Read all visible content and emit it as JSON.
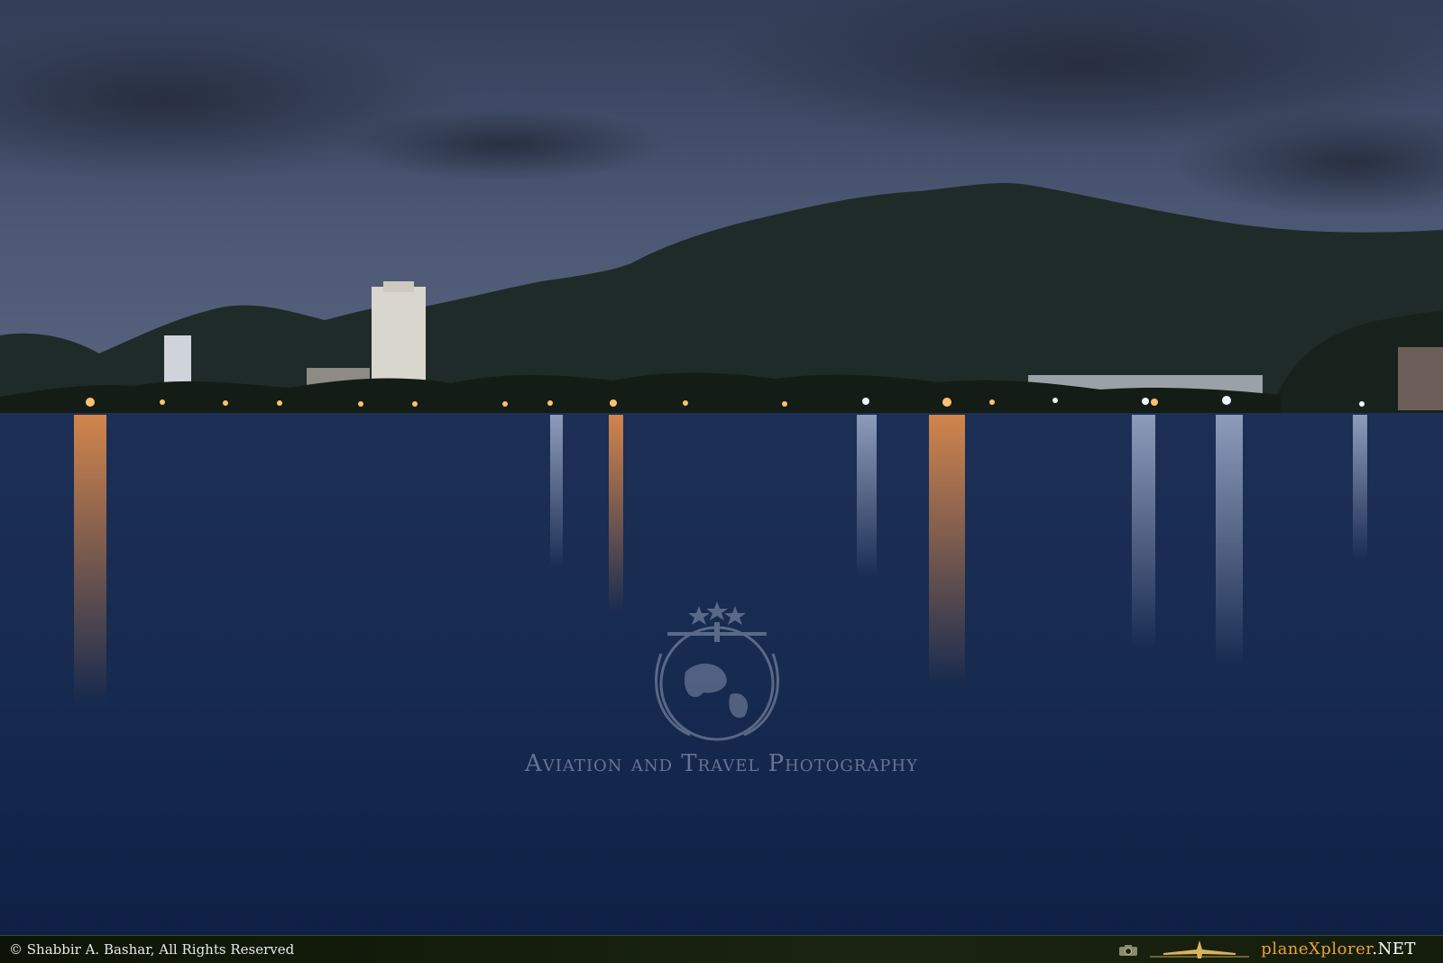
{
  "watermark": {
    "text": "Aviation and Travel Photography",
    "emblem": "planexplorer-globe-plane-emblem"
  },
  "footer": {
    "copyright": "© Shabbir A. Bashar, All Rights Reserved",
    "brand_main": "planeXplorer",
    "brand_tld": ".NET",
    "camera_icon": "camera-icon",
    "plane_icon": "airplane-icon"
  },
  "colors": {
    "sky": "#3a4763",
    "sea": "#15264a",
    "hill": "#1d2a26",
    "city_light": "#ffb347",
    "brand_orange": "#e9a23a"
  }
}
